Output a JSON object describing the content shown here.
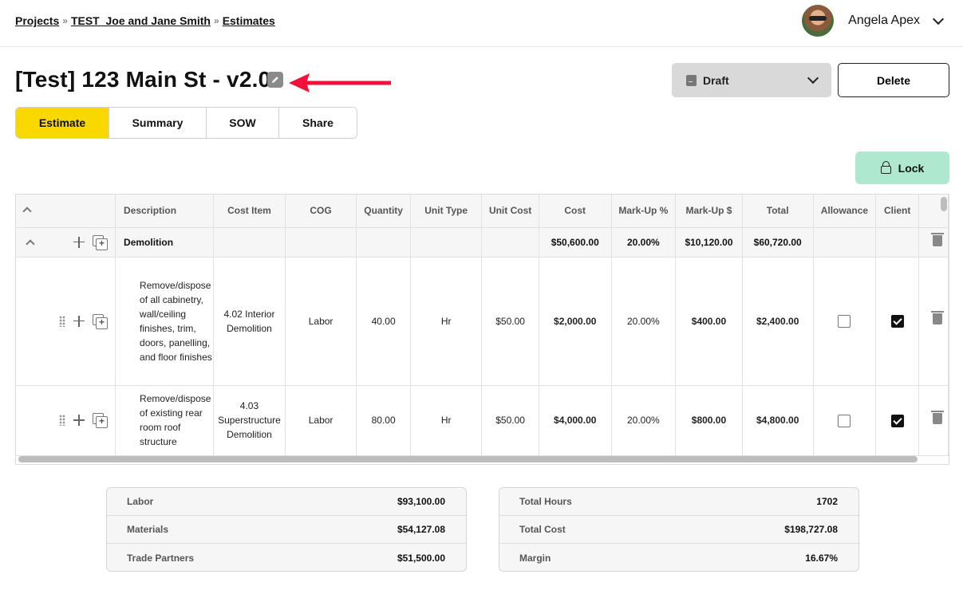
{
  "breadcrumb": {
    "items": [
      "Projects",
      "TEST_Joe and Jane Smith",
      "Estimates"
    ],
    "separator": "»"
  },
  "user": {
    "name": "Angela Apex"
  },
  "page": {
    "title": "[Test] 123 Main St - v2.0",
    "status": "Draft",
    "delete_label": "Delete",
    "lock_label": "Lock"
  },
  "tabs": [
    {
      "label": "Estimate",
      "active": true
    },
    {
      "label": "Summary",
      "active": false
    },
    {
      "label": "SOW",
      "active": false
    },
    {
      "label": "Share",
      "active": false
    }
  ],
  "table": {
    "columns": [
      "Description",
      "Cost Item",
      "COG",
      "Quantity",
      "Unit Type",
      "Unit Cost",
      "Cost",
      "Mark-Up %",
      "Mark-Up $",
      "Total",
      "Allowance",
      "Client"
    ],
    "group": {
      "name": "Demolition",
      "cost": "$50,600.00",
      "markup_pct": "20.00%",
      "markup_amt": "$10,120.00",
      "total": "$60,720.00"
    },
    "rows": [
      {
        "description": "Remove/dispose of all cabinetry, wall/ceiling finishes, trim, doors, panelling, and floor finishes",
        "cost_item": "4.02 Interior Demolition",
        "cog": "Labor",
        "quantity": "40.00",
        "unit_type": "Hr",
        "unit_cost": "$50.00",
        "cost": "$2,000.00",
        "markup_pct": "20.00%",
        "markup_amt": "$400.00",
        "total": "$2,400.00",
        "allowance": false,
        "client": true
      },
      {
        "description": "Remove/dispose of existing rear room roof structure",
        "cost_item": "4.03 Superstructure Demolition",
        "cog": "Labor",
        "quantity": "80.00",
        "unit_type": "Hr",
        "unit_cost": "$50.00",
        "cost": "$4,000.00",
        "markup_pct": "20.00%",
        "markup_amt": "$800.00",
        "total": "$4,800.00",
        "allowance": false,
        "client": true
      }
    ]
  },
  "summary_left": [
    {
      "label": "Labor",
      "value": "$93,100.00"
    },
    {
      "label": "Materials",
      "value": "$54,127.08"
    },
    {
      "label": "Trade Partners",
      "value": "$51,500.00"
    }
  ],
  "summary_right": [
    {
      "label": "Total Hours",
      "value": "1702"
    },
    {
      "label": "Total Cost",
      "value": "$198,727.08"
    },
    {
      "label": "Margin",
      "value": "16.67%"
    }
  ],
  "colors": {
    "accent_yellow": "#f9d800",
    "lock_green": "#aee9cf",
    "annotation_arrow": "#f0103a"
  }
}
